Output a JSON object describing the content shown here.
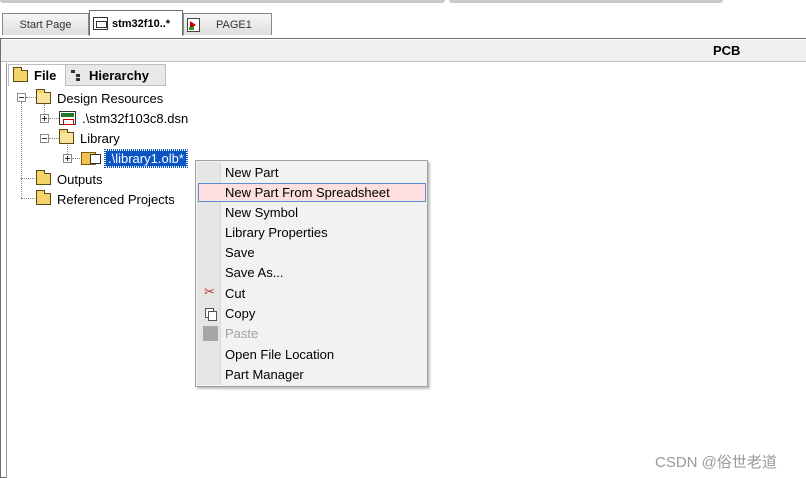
{
  "tabs": {
    "start_page": "Start Page",
    "active_doc": "stm32f10..*",
    "page1": "PAGE1"
  },
  "header": {
    "pcb_label": "PCB"
  },
  "panel_tabs": {
    "file": "File",
    "hierarchy": "Hierarchy"
  },
  "tree": {
    "design_resources": "Design Resources",
    "dsn_file": ".\\stm32f103c8.dsn",
    "library": "Library",
    "library_file": ".\\library1.olb*",
    "outputs": "Outputs",
    "referenced_projects": "Referenced Projects"
  },
  "context_menu": {
    "items": [
      {
        "label": "New Part",
        "icon": "",
        "state": "normal"
      },
      {
        "label": "New Part From Spreadsheet",
        "icon": "",
        "state": "highlighted"
      },
      {
        "label": "New Symbol",
        "icon": "",
        "state": "normal"
      },
      {
        "label": "Library Properties",
        "icon": "",
        "state": "normal"
      },
      {
        "label": "Save",
        "icon": "",
        "state": "normal"
      },
      {
        "label": "Save As...",
        "icon": "",
        "state": "normal"
      },
      {
        "label": "Cut",
        "icon": "scissors-icon",
        "state": "normal"
      },
      {
        "label": "Copy",
        "icon": "copy-icon",
        "state": "normal"
      },
      {
        "label": "Paste",
        "icon": "paste-icon",
        "state": "disabled"
      },
      {
        "label": "Open File Location",
        "icon": "",
        "state": "normal"
      },
      {
        "label": "Part Manager",
        "icon": "",
        "state": "normal"
      }
    ]
  },
  "watermark": "CSDN @俗世老道",
  "colors": {
    "selection": "#0a54c4",
    "menu_highlight": "#fde0de",
    "menu_highlight_border": "#5c8fcf"
  }
}
